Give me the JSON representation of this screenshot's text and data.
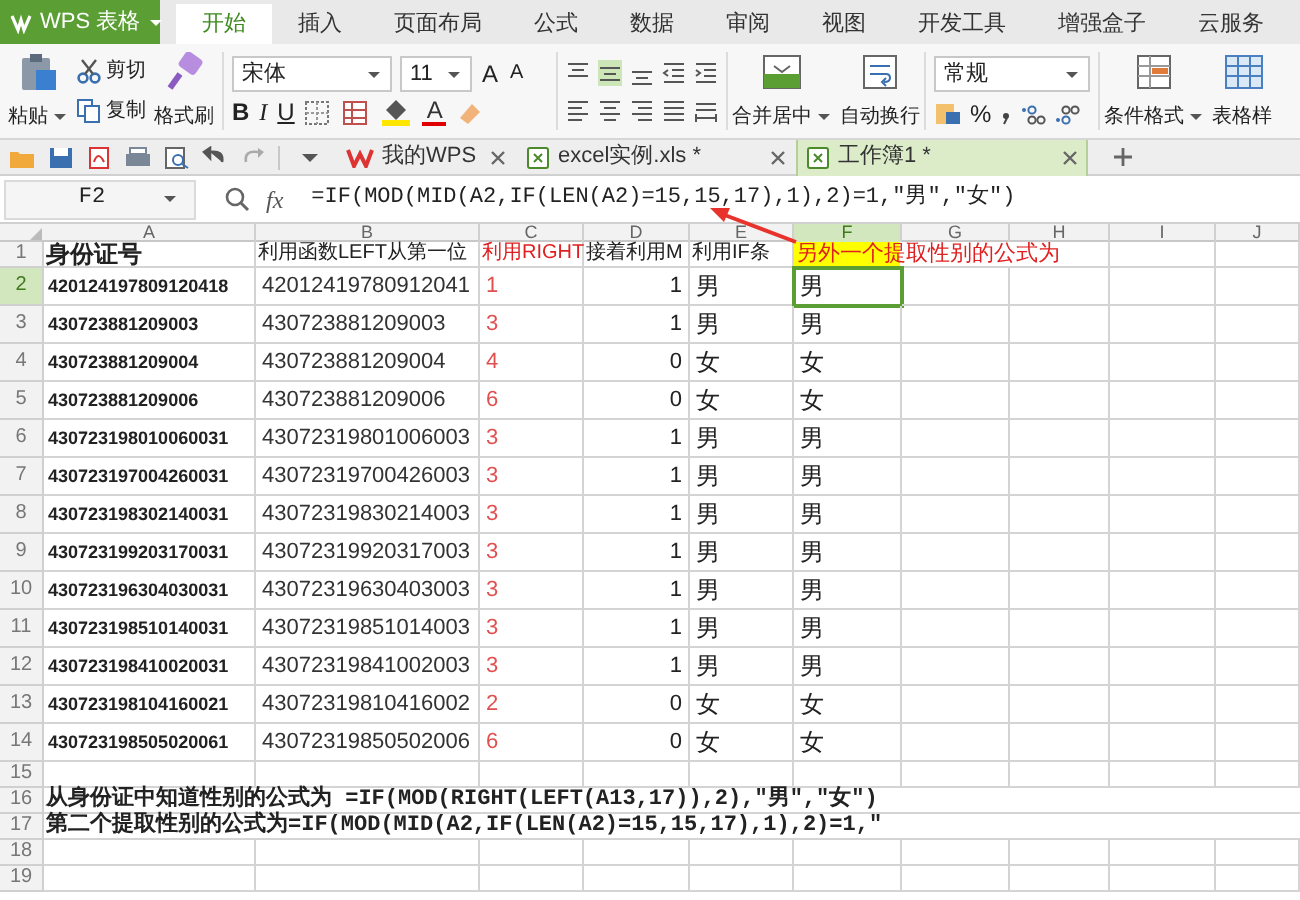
{
  "app": {
    "title": "WPS 表格"
  },
  "ribbon_tabs": [
    {
      "label": "开始",
      "selected": true
    },
    {
      "label": "插入",
      "selected": false
    },
    {
      "label": "页面布局",
      "selected": false
    },
    {
      "label": "公式",
      "selected": false
    },
    {
      "label": "数据",
      "selected": false
    },
    {
      "label": "审阅",
      "selected": false
    },
    {
      "label": "视图",
      "selected": false
    },
    {
      "label": "开发工具",
      "selected": false
    },
    {
      "label": "增强盒子",
      "selected": false
    },
    {
      "label": "云服务",
      "selected": false
    }
  ],
  "ribbon": {
    "paste": "粘贴",
    "cut": "剪切",
    "copy": "复制",
    "format_painter": "格式刷",
    "font_name": "宋体",
    "font_size": "11",
    "grow_font": "A",
    "shrink_font": "A",
    "bold": "B",
    "italic": "I",
    "underline": "U",
    "font_color": "A",
    "merge_center": "合并居中",
    "wrap_text": "自动换行",
    "number_format": "常规",
    "percent": "%",
    "conditional_format": "条件格式",
    "table_style": "表格样"
  },
  "doc_tabs": [
    {
      "label": "我的WPS",
      "selected": false
    },
    {
      "label": "excel实例.xls *",
      "selected": false
    },
    {
      "label": "工作簿1 *",
      "selected": true
    }
  ],
  "formula_bar": {
    "cell": "F2",
    "fx": "fx",
    "formula": "=IF(MOD(MID(A2,IF(LEN(A2)=15,15,17),1),2)=1,\"男\",\"女\")"
  },
  "sheet": {
    "columns": [
      {
        "label": "A",
        "selected": false
      },
      {
        "label": "B",
        "selected": false
      },
      {
        "label": "C",
        "selected": false
      },
      {
        "label": "D",
        "selected": false
      },
      {
        "label": "E",
        "selected": false
      },
      {
        "label": "F",
        "selected": true
      },
      {
        "label": "G",
        "selected": false
      },
      {
        "label": "H",
        "selected": false
      },
      {
        "label": "I",
        "selected": false
      },
      {
        "label": "J",
        "selected": false
      }
    ],
    "rows": [
      {
        "number": "1",
        "kind": "header",
        "selected": false,
        "cells": [
          "身份证号",
          "利用函数LEFT从第一位",
          "利用RIGHT",
          "接着利用M",
          "利用IF条",
          "另外一个提取性别的公式为"
        ]
      },
      {
        "number": "2",
        "kind": "data",
        "selected": true,
        "cells": [
          "420124197809120418",
          "42012419780912041",
          "1",
          "1",
          "男",
          "男"
        ]
      },
      {
        "number": "3",
        "kind": "data",
        "selected": false,
        "cells": [
          "430723881209003",
          "430723881209003",
          "3",
          "1",
          "男",
          "男"
        ]
      },
      {
        "number": "4",
        "kind": "data",
        "selected": false,
        "cells": [
          "430723881209004",
          "430723881209004",
          "4",
          "0",
          "女",
          "女"
        ]
      },
      {
        "number": "5",
        "kind": "data",
        "selected": false,
        "cells": [
          "430723881209006",
          "430723881209006",
          "6",
          "0",
          "女",
          "女"
        ]
      },
      {
        "number": "6",
        "kind": "data",
        "selected": false,
        "cells": [
          "430723198010060031",
          "43072319801006003",
          "3",
          "1",
          "男",
          "男"
        ]
      },
      {
        "number": "7",
        "kind": "data",
        "selected": false,
        "cells": [
          "430723197004260031",
          "43072319700426003",
          "3",
          "1",
          "男",
          "男"
        ]
      },
      {
        "number": "8",
        "kind": "data",
        "selected": false,
        "cells": [
          "430723198302140031",
          "43072319830214003",
          "3",
          "1",
          "男",
          "男"
        ]
      },
      {
        "number": "9",
        "kind": "data",
        "selected": false,
        "cells": [
          "430723199203170031",
          "43072319920317003",
          "3",
          "1",
          "男",
          "男"
        ]
      },
      {
        "number": "10",
        "kind": "data",
        "selected": false,
        "cells": [
          "430723196304030031",
          "43072319630403003",
          "3",
          "1",
          "男",
          "男"
        ]
      },
      {
        "number": "11",
        "kind": "data",
        "selected": false,
        "cells": [
          "430723198510140031",
          "43072319851014003",
          "3",
          "1",
          "男",
          "男"
        ]
      },
      {
        "number": "12",
        "kind": "data",
        "selected": false,
        "cells": [
          "430723198410020031",
          "43072319841002003",
          "3",
          "1",
          "男",
          "男"
        ]
      },
      {
        "number": "13",
        "kind": "data",
        "selected": false,
        "cells": [
          "430723198104160021",
          "43072319810416002",
          "2",
          "0",
          "女",
          "女"
        ]
      },
      {
        "number": "14",
        "kind": "data",
        "selected": false,
        "cells": [
          "430723198505020061",
          "43072319850502006",
          "6",
          "0",
          "女",
          "女"
        ]
      },
      {
        "number": "15",
        "kind": "empty",
        "selected": false
      },
      {
        "number": "16",
        "kind": "note",
        "selected": false,
        "text": "从身份证中知道性别的公式为 =IF(MOD(RIGHT(LEFT(A13,17)),2),\"男\",\"女\")"
      },
      {
        "number": "17",
        "kind": "note",
        "selected": false,
        "text": "第二个提取性别的公式为=IF(MOD(MID(A2,IF(LEN(A2)=15,15,17),1),2)=1,\""
      },
      {
        "number": "18",
        "kind": "empty",
        "selected": false
      },
      {
        "number": "19",
        "kind": "empty",
        "selected": false
      }
    ]
  }
}
